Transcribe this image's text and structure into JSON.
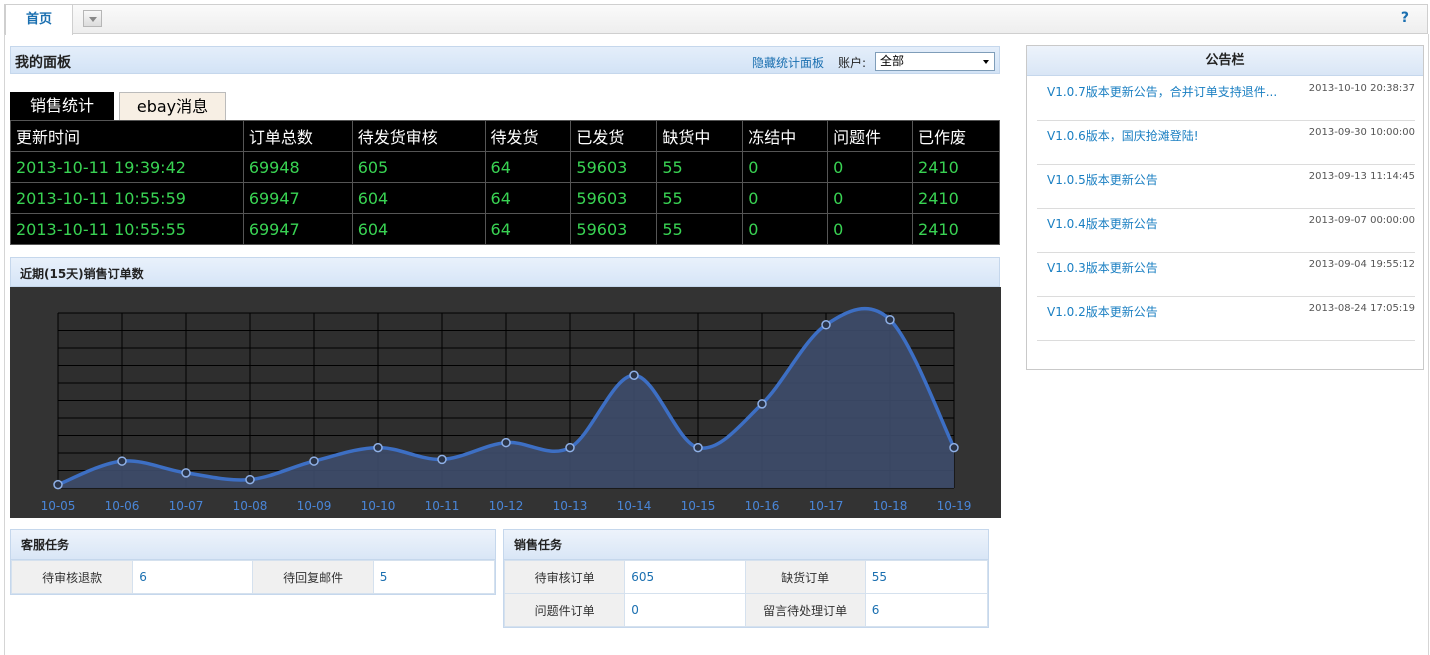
{
  "top_tabs": {
    "home": "首页",
    "help": "?"
  },
  "dashboard": {
    "title": "我的面板",
    "hide_link": "隐藏统计面板",
    "account_label": "账户:",
    "account_value": "全部"
  },
  "stat_tabs": [
    "销售统计",
    "ebay消息"
  ],
  "stats_table": {
    "headers": [
      "更新时间",
      "订单总数",
      "待发货审核",
      "待发货",
      "已发货",
      "缺货中",
      "冻结中",
      "问题件",
      "已作废"
    ],
    "rows": [
      [
        "2013-10-11 19:39:42",
        "69948",
        "605",
        "64",
        "59603",
        "55",
        "0",
        "0",
        "2410"
      ],
      [
        "2013-10-11 10:55:59",
        "69947",
        "604",
        "64",
        "59603",
        "55",
        "0",
        "0",
        "2410"
      ],
      [
        "2013-10-11 10:55:55",
        "69947",
        "604",
        "64",
        "59603",
        "55",
        "0",
        "0",
        "2410"
      ]
    ]
  },
  "chart_data": {
    "type": "area",
    "title": "近期(15天)销售订单数",
    "x": [
      "10-05",
      "10-06",
      "10-07",
      "10-08",
      "10-09",
      "10-10",
      "10-11",
      "10-12",
      "10-13",
      "10-14",
      "10-15",
      "10-16",
      "10-17",
      "10-18",
      "10-19"
    ],
    "series": [
      {
        "values": [
          2,
          16,
          9,
          5,
          16,
          24,
          17,
          27,
          24,
          67,
          24,
          50,
          97,
          100,
          24
        ]
      }
    ],
    "ylim": [
      0,
      104
    ],
    "grid": true,
    "colors": {
      "line": "#3d6fc4",
      "fill": "#3e4d6b",
      "grid": "#000000",
      "plot": "#2e2e2e",
      "tick": "#4a86d8"
    }
  },
  "cs_tasks": {
    "title": "客服任务",
    "items": [
      {
        "label": "待审核退款",
        "value": "6"
      },
      {
        "label": "待回复邮件",
        "value": "5"
      }
    ]
  },
  "sales_tasks": {
    "title": "销售任务",
    "items": [
      {
        "label": "待审核订单",
        "value": "605"
      },
      {
        "label": "缺货订单",
        "value": "55"
      },
      {
        "label": "问题件订单",
        "value": "0"
      },
      {
        "label": "留言待处理订单",
        "value": "6"
      }
    ]
  },
  "notice_board": {
    "title": "公告栏",
    "items": [
      {
        "title": "V1.0.7版本更新公告，合并订单支持退件...",
        "date": "2013-10-10 20:38:37"
      },
      {
        "title": "V1.0.6版本，国庆抢滩登陆!",
        "date": "2013-09-30 10:00:00"
      },
      {
        "title": "V1.0.5版本更新公告",
        "date": "2013-09-13 11:14:45"
      },
      {
        "title": "V1.0.4版本更新公告",
        "date": "2013-09-07 00:00:00"
      },
      {
        "title": "V1.0.3版本更新公告",
        "date": "2013-09-04 19:55:12"
      },
      {
        "title": "V1.0.2版本更新公告",
        "date": "2013-08-24 17:05:19"
      }
    ]
  }
}
